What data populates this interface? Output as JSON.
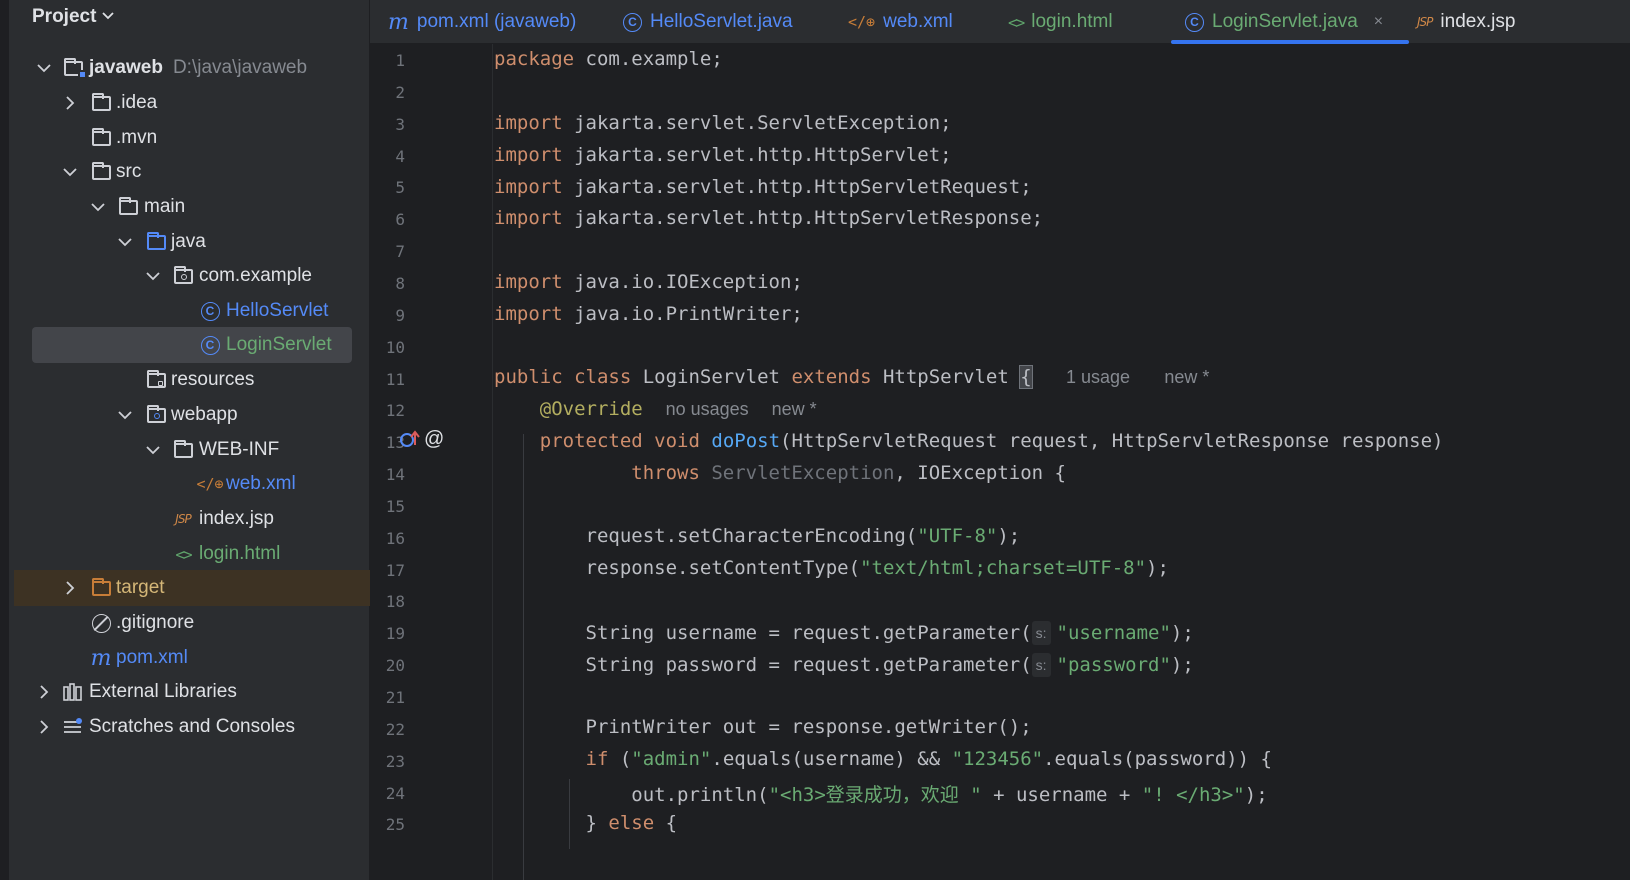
{
  "project_panel": {
    "title": "Project",
    "tree": [
      {
        "label": "javaweb",
        "path": "D:\\java\\javaweb",
        "icon": "module-folder-icon",
        "expanded": true
      },
      {
        "label": ".idea",
        "icon": "folder-icon",
        "expanded": false
      },
      {
        "label": ".mvn",
        "icon": "folder-icon"
      },
      {
        "label": "src",
        "icon": "folder-icon",
        "expanded": true
      },
      {
        "label": "main",
        "icon": "folder-icon",
        "expanded": true
      },
      {
        "label": "java",
        "icon": "source-folder-icon",
        "expanded": true
      },
      {
        "label": "com.example",
        "icon": "package-icon",
        "expanded": true
      },
      {
        "label": "HelloServlet",
        "icon": "class-icon"
      },
      {
        "label": "LoginServlet",
        "icon": "class-icon",
        "selected": true
      },
      {
        "label": "resources",
        "icon": "resources-folder-icon"
      },
      {
        "label": "webapp",
        "icon": "web-folder-icon",
        "expanded": true
      },
      {
        "label": "WEB-INF",
        "icon": "folder-icon",
        "expanded": true
      },
      {
        "label": "web.xml",
        "icon": "xml-icon"
      },
      {
        "label": "index.jsp",
        "icon": "jsp-icon"
      },
      {
        "label": "login.html",
        "icon": "html-icon"
      },
      {
        "label": "target",
        "icon": "excluded-folder-icon",
        "expanded": false
      },
      {
        "label": ".gitignore",
        "icon": "ignore-icon"
      },
      {
        "label": "pom.xml",
        "icon": "maven-icon"
      },
      {
        "label": "External Libraries",
        "icon": "library-icon",
        "expanded": false
      },
      {
        "label": "Scratches and Consoles",
        "icon": "scratches-icon",
        "expanded": false
      }
    ]
  },
  "tabs": [
    {
      "label": "pom.xml (javaweb)",
      "icon": "maven-icon"
    },
    {
      "label": "HelloServlet.java",
      "icon": "class-icon"
    },
    {
      "label": "web.xml",
      "icon": "xml-icon"
    },
    {
      "label": "login.html",
      "icon": "html-icon"
    },
    {
      "label": "LoginServlet.java",
      "icon": "class-icon",
      "active": true,
      "close": "×"
    },
    {
      "label": "index.jsp",
      "icon": "jsp-icon"
    }
  ],
  "editor": {
    "line_numbers": [
      "1",
      "2",
      "3",
      "4",
      "5",
      "6",
      "7",
      "8",
      "9",
      "10",
      "11",
      "12",
      "13",
      "14",
      "15",
      "16",
      "17",
      "18",
      "19",
      "20",
      "21",
      "22",
      "23",
      "24",
      "25"
    ],
    "hints": {
      "class_usage": "1 usage",
      "class_new": "new *",
      "override_usage": "no usages",
      "override_new": "new *",
      "param_s": "s:"
    },
    "lines": {
      "l1_kw": "package",
      "l1_rest": " com.example;",
      "l3_kw": "import",
      "l3_rest": " jakarta.servlet.ServletException;",
      "l4_kw": "import",
      "l4_rest": " jakarta.servlet.http.HttpServlet;",
      "l5_kw": "import",
      "l5_rest": " jakarta.servlet.http.HttpServletRequest;",
      "l6_kw": "import",
      "l6_rest": " jakarta.servlet.http.HttpServletResponse;",
      "l8_kw": "import",
      "l8_rest": " java.io.IOException;",
      "l9_kw": "import",
      "l9_rest": " java.io.PrintWriter;",
      "l11_kw1": "public class",
      "l11_name": " LoginServlet ",
      "l11_kw2": "extends",
      "l11_rest": " HttpServlet ",
      "l11_brace": "{",
      "l12_ann": "@Override",
      "l13_kw": "protected void",
      "l13_fn": "doPost",
      "l13_rest": "(HttpServletRequest request, HttpServletResponse response)",
      "l14_kw": "throws",
      "l14_dim": " ServletException",
      "l14_rest": ", IOException {",
      "l16_a": "request.setCharacterEncoding(",
      "l16_str": "\"UTF-8\"",
      "l16_b": ");",
      "l17_a": "response.setContentType(",
      "l17_str": "\"text/html;charset=UTF-8\"",
      "l17_b": ");",
      "l19_a": "String username = request.getParameter(",
      "l19_str": "\"username\"",
      "l19_b": ");",
      "l20_a": "String password = request.getParameter(",
      "l20_str": "\"password\"",
      "l20_b": ");",
      "l22": "PrintWriter out = response.getWriter();",
      "l23_kw": "if",
      "l23_a": " (",
      "l23_str1": "\"admin\"",
      "l23_b": ".equals(username) && ",
      "l23_str2": "\"123456\"",
      "l23_c": ".equals(password)) {",
      "l24_a": "out.println(",
      "l24_str1": "\"<h3>登录成功，欢迎 \"",
      "l24_b": " + username + ",
      "l24_str2": "\"! </h3>\"",
      "l24_c": ");",
      "l25_a": "} ",
      "l25_kw": "else",
      "l25_b": " {"
    }
  }
}
